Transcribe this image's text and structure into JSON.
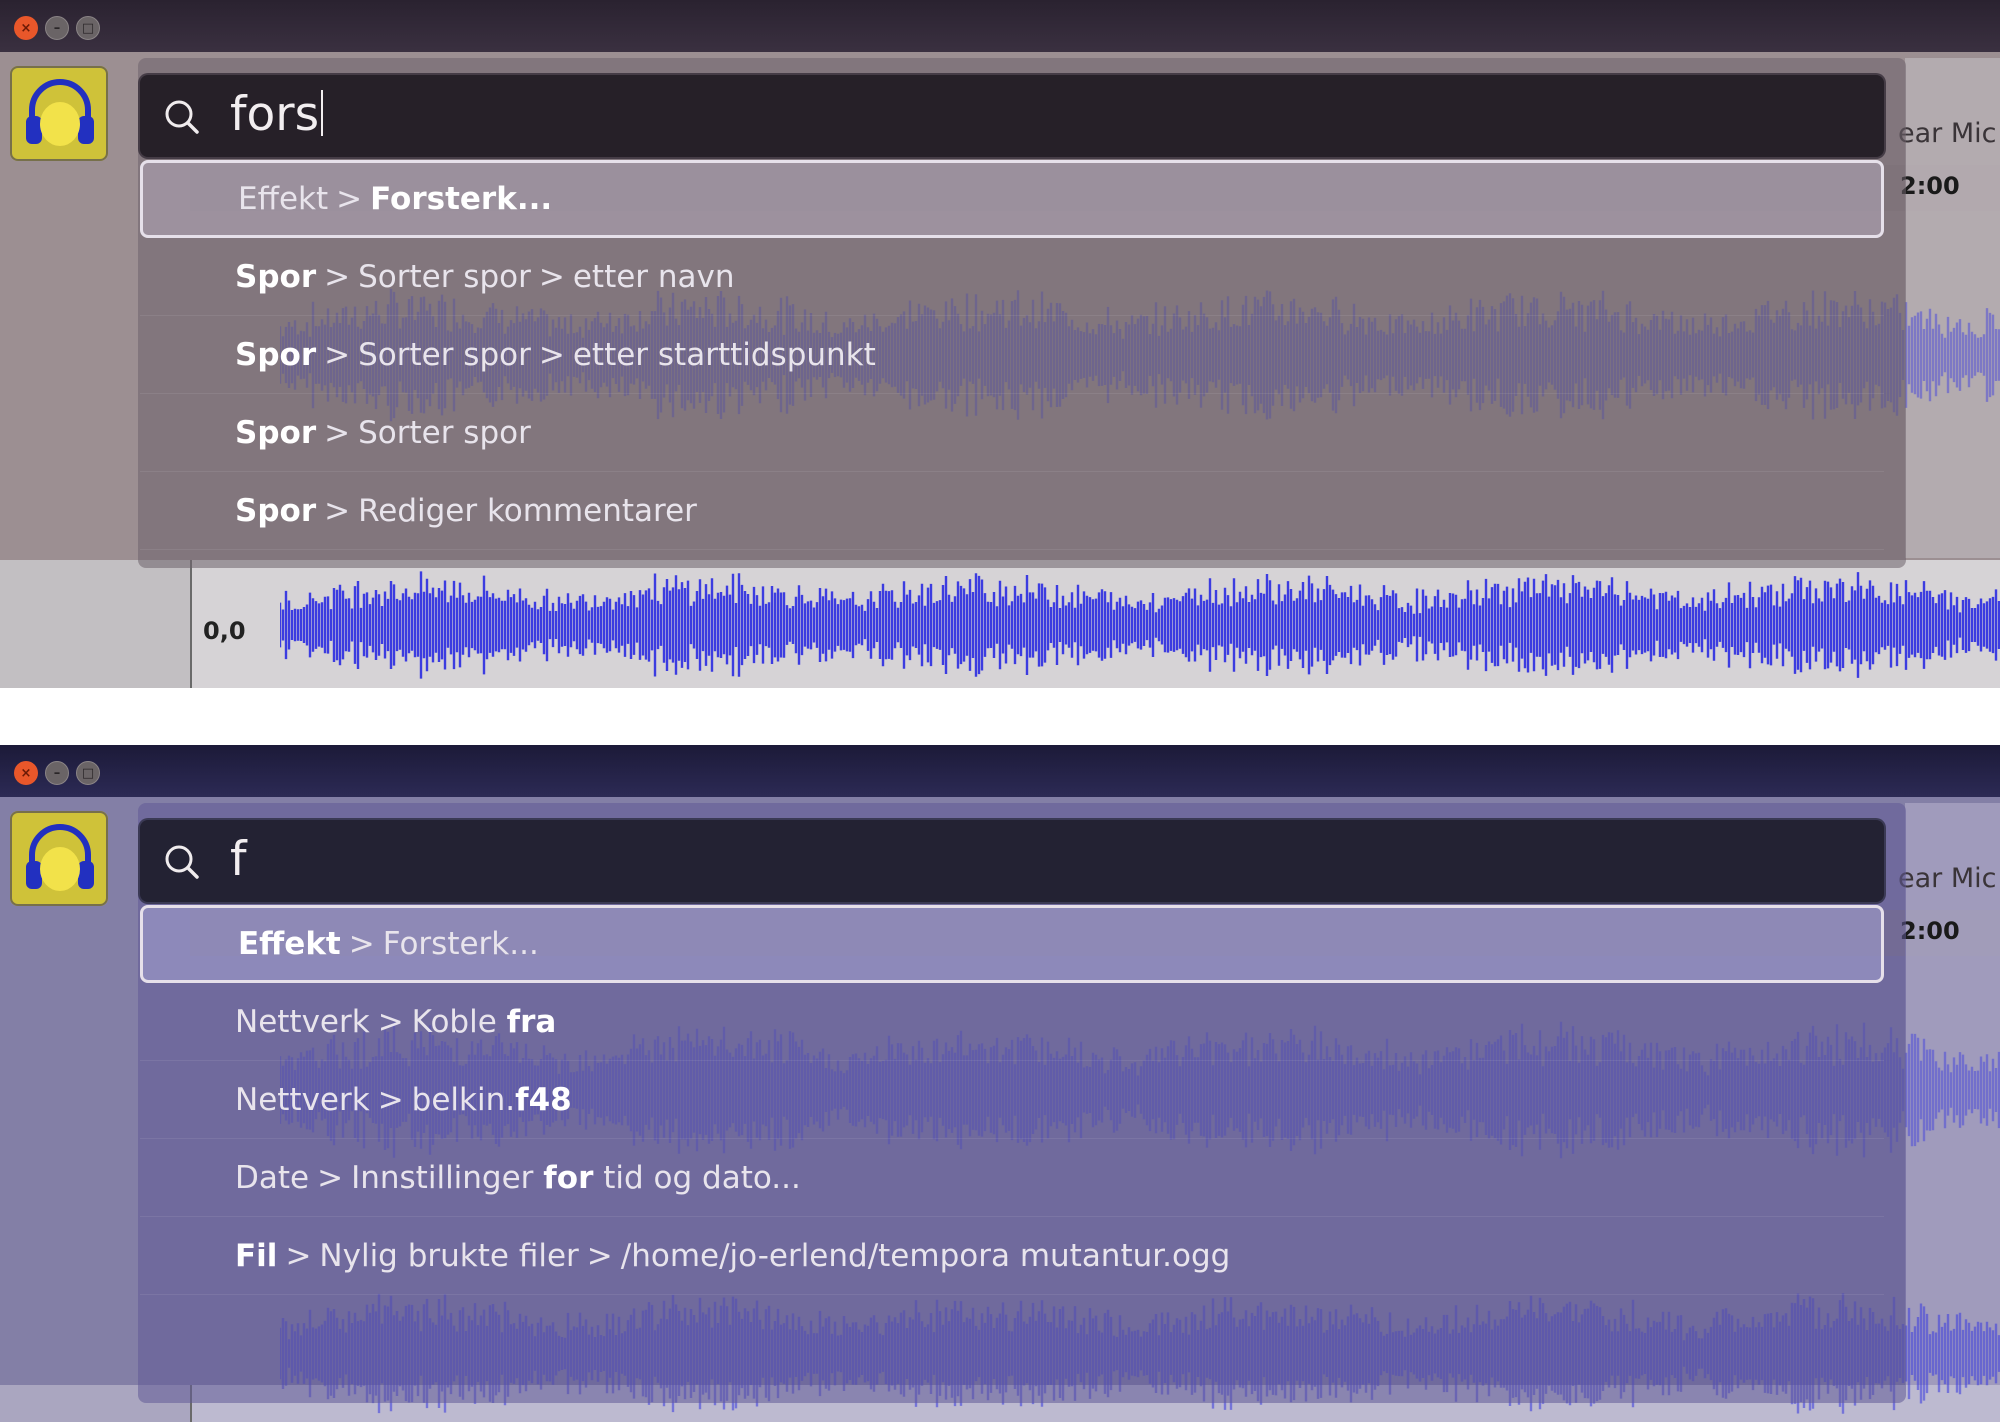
{
  "colors": {
    "close_button": "#e9572a",
    "waveform": "#3c3ce0",
    "launcher_icon": "#cfc239",
    "headphones": "#2230c0"
  },
  "top": {
    "search": {
      "query": "fors"
    },
    "right_label": "ear Mic",
    "right_time": "2:00",
    "zero_label": "0,0",
    "results": [
      {
        "parts": [
          {
            "text": "Effekt",
            "bold": false
          },
          {
            "text": "Forsterk...",
            "bold": true
          }
        ]
      },
      {
        "parts": [
          {
            "text": "Spor",
            "bold": true
          },
          {
            "text": "Sorter spor",
            "bold": false
          },
          {
            "text": "etter navn",
            "bold": false
          }
        ]
      },
      {
        "parts": [
          {
            "text": "Spor",
            "bold": true
          },
          {
            "text": "Sorter spor",
            "bold": false
          },
          {
            "text": "etter starttidspunkt",
            "bold": false
          }
        ]
      },
      {
        "parts": [
          {
            "text": "Spor",
            "bold": true
          },
          {
            "text": "Sorter spor",
            "bold": false
          }
        ]
      },
      {
        "parts": [
          {
            "text": "Spor",
            "bold": true
          },
          {
            "text": "Rediger kommentarer",
            "bold": false
          }
        ]
      }
    ]
  },
  "bottom": {
    "search": {
      "query": "f"
    },
    "right_label": "ear Mic",
    "right_time": "2:00",
    "results": [
      {
        "parts": [
          {
            "text": "Effekt",
            "bold": true
          },
          {
            "text": "Forsterk...",
            "bold": false
          }
        ]
      },
      {
        "parts": [
          {
            "text": "Nettverk",
            "bold": false
          },
          {
            "text": "Koble ",
            "bold": false,
            "tail": "fra",
            "tail_bold": true
          }
        ]
      },
      {
        "parts": [
          {
            "text": "Nettverk",
            "bold": false
          },
          {
            "text": "belkin.",
            "bold": false,
            "tail": "f48",
            "tail_bold": true
          }
        ]
      },
      {
        "parts": [
          {
            "text": "Date",
            "bold": false
          },
          {
            "text": "Innstillinger ",
            "bold": false,
            "tail": "for",
            "tail_bold": true,
            "tail2": " tid og dato..."
          }
        ]
      },
      {
        "parts": [
          {
            "text": "Fil",
            "bold": true
          },
          {
            "text": "Nylig brukte filer",
            "bold": false
          },
          {
            "text": "/home/jo-erlend/tempora mutantur.ogg",
            "bold": false
          }
        ]
      }
    ]
  }
}
